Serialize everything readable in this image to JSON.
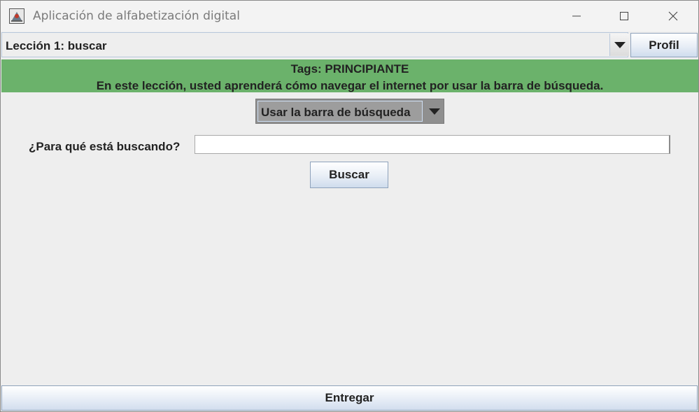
{
  "window": {
    "title": "Aplicación de alfabetización digital",
    "icon": "java-app-icon"
  },
  "controls": {
    "minimize": "minimize-icon",
    "maximize": "maximize-icon",
    "close": "close-icon"
  },
  "lesson_selector": {
    "selected": "Lección 1: buscar"
  },
  "profile_button": {
    "label": "Profil"
  },
  "banner": {
    "tags": "Tags: PRINCIPIANTE",
    "description": "En este lección, usted aprenderá cómo navegar el internet por usar la barra de búsqueda.",
    "color": "#6bb26b"
  },
  "sub_lesson_selector": {
    "selected": "Usar la barra de búsqueda"
  },
  "search": {
    "label": "¿Para qué está buscando?",
    "value": "",
    "button_label": "Buscar"
  },
  "submit_button": {
    "label": "Entregar"
  }
}
